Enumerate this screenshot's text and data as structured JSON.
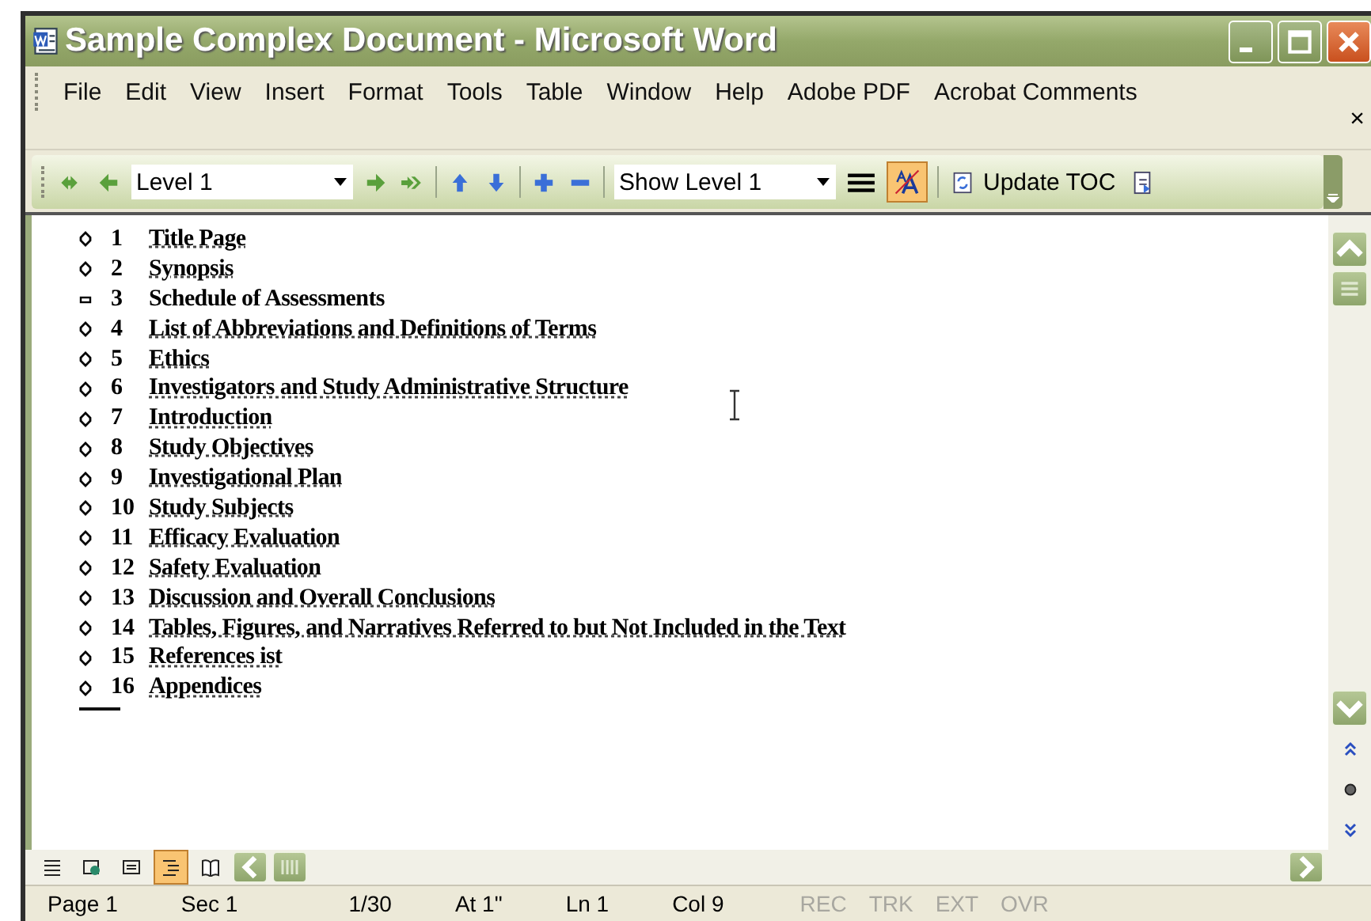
{
  "window": {
    "title": "Sample Complex Document - Microsoft Word"
  },
  "menu": [
    "File",
    "Edit",
    "View",
    "Insert",
    "Format",
    "Tools",
    "Table",
    "Window",
    "Help",
    "Adobe PDF",
    "Acrobat Comments"
  ],
  "menu_close": "×",
  "outlining_toolbar": {
    "level": "Level 1",
    "show_level": "Show Level 1",
    "show_formatting": true,
    "update_toc": "Update TOC"
  },
  "outline": [
    {
      "number": "1",
      "title": "Title Page",
      "has_subheadings": true
    },
    {
      "number": "2",
      "title": "Synopsis",
      "has_subheadings": true
    },
    {
      "number": "3",
      "title": "Schedule of Assessments",
      "has_subheadings": false
    },
    {
      "number": "4",
      "title": "List of Abbreviations and Definitions of Terms",
      "has_subheadings": true
    },
    {
      "number": "5",
      "title": "Ethics",
      "has_subheadings": true
    },
    {
      "number": "6",
      "title": "Investigators and Study Administrative Structure",
      "has_subheadings": true
    },
    {
      "number": "7",
      "title": "Introduction",
      "has_subheadings": true
    },
    {
      "number": "8",
      "title": "Study Objectives",
      "has_subheadings": true
    },
    {
      "number": "9",
      "title": "Investigational Plan",
      "has_subheadings": true
    },
    {
      "number": "10",
      "title": "Study Subjects",
      "has_subheadings": true
    },
    {
      "number": "11",
      "title": "Efficacy Evaluation",
      "has_subheadings": true
    },
    {
      "number": "12",
      "title": "Safety Evaluation",
      "has_subheadings": true
    },
    {
      "number": "13",
      "title": "Discussion and Overall Conclusions",
      "has_subheadings": true
    },
    {
      "number": "14",
      "title": "Tables, Figures, and Narratives Referred to but Not Included in the Text",
      "has_subheadings": true
    },
    {
      "number": "15",
      "title": "References ist",
      "has_subheadings": true
    },
    {
      "number": "16",
      "title": "Appendices",
      "has_subheadings": true
    }
  ],
  "view_buttons": [
    {
      "kind": "normal",
      "selected": false
    },
    {
      "kind": "web",
      "selected": false
    },
    {
      "kind": "print",
      "selected": false
    },
    {
      "kind": "outline",
      "selected": true
    },
    {
      "kind": "reading",
      "selected": false
    }
  ],
  "status_bar": [
    {
      "text": "Page 1",
      "enabled": true
    },
    {
      "text": "Sec 1",
      "enabled": true
    },
    {
      "text": "1/30",
      "enabled": true
    },
    {
      "text": "At 1\"",
      "enabled": true
    },
    {
      "text": "Ln 1",
      "enabled": true
    },
    {
      "text": "Col 9",
      "enabled": true
    },
    {
      "text": "REC",
      "enabled": false
    },
    {
      "text": "TRK",
      "enabled": false
    },
    {
      "text": "EXT",
      "enabled": false
    },
    {
      "text": "OVR",
      "enabled": false
    }
  ]
}
